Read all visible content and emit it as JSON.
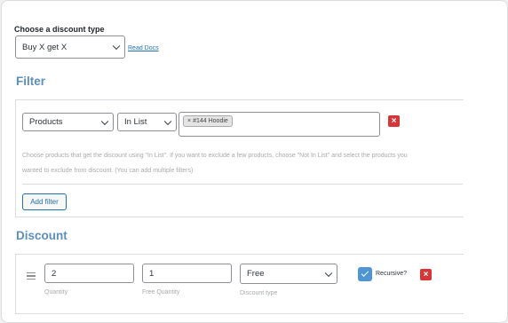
{
  "discount_type": {
    "label": "Choose a discount type",
    "selected": "Buy X get X",
    "read_docs": "Read Docs"
  },
  "filter": {
    "title": "Filter",
    "field": "Products",
    "operator": "In List",
    "chip_remove": "×",
    "chip_label": "#144 Hoodie",
    "remove_icon": "×",
    "help_line1": "Choose products that get the discount using \"In List\". If you want to exclude a few products, choose \"Not In List\" and select the products you",
    "help_line2": "wanted to exclude from discount. (You can add multiple filters)",
    "add_filter": "Add filter"
  },
  "discount": {
    "title": "Discount",
    "quantity_value": "2",
    "quantity_label": "Quantity",
    "free_quantity_value": "1",
    "free_quantity_label": "Free Quantity",
    "discount_type_value": "Free",
    "discount_type_label": "Discount type",
    "recursive_label": "Recursive?",
    "recursive_checked": true,
    "remove_icon": "×"
  },
  "colors": {
    "accent": "#2271b1",
    "section_title": "#5c8fbd",
    "danger": "#d63638",
    "checkbox": "#4f94d4"
  }
}
